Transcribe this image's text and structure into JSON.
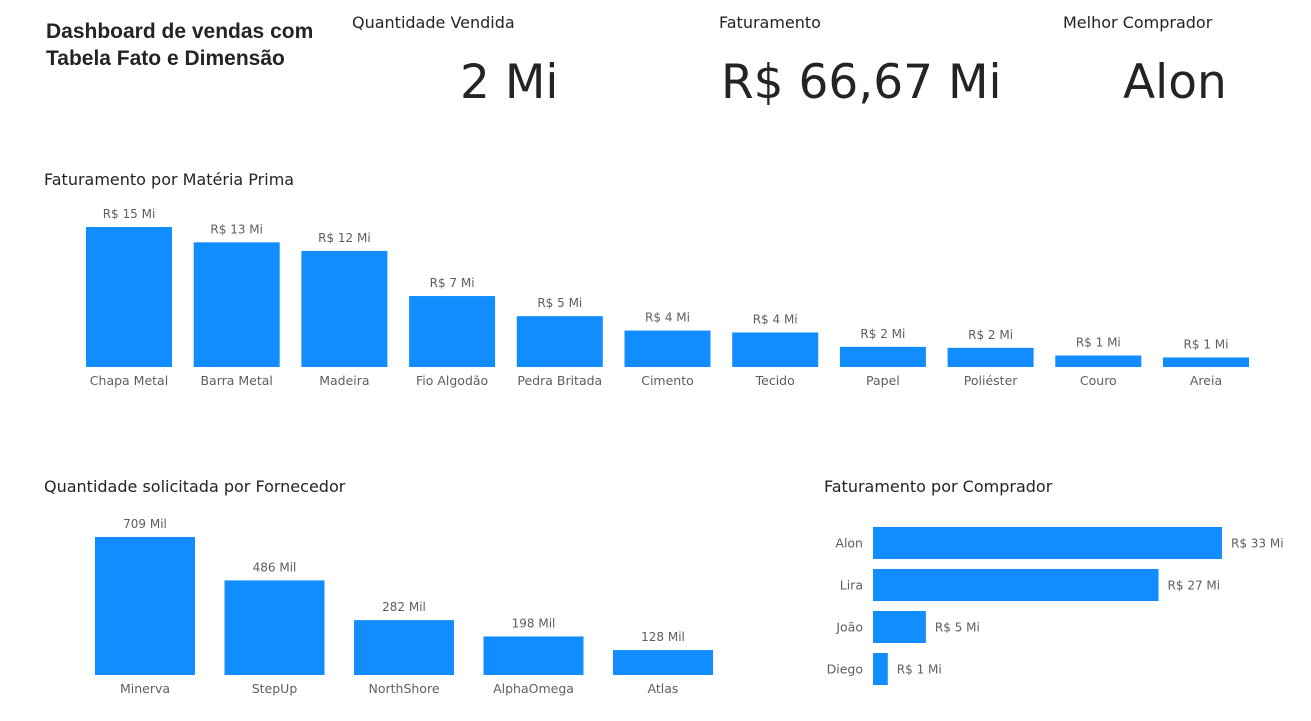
{
  "dashboard": {
    "title": "Dashboard de vendas com Tabela Fato e Dimensão"
  },
  "cards": [
    {
      "label": "Quantidade Vendida",
      "value": "2 Mi"
    },
    {
      "label": "Faturamento",
      "value": "R$ 66,67 Mi"
    },
    {
      "label": "Melhor Comprador",
      "value": "Alon"
    }
  ],
  "colors": {
    "bar": "#118DFF",
    "text": "#252423",
    "label": "#605E5C"
  },
  "chart_data": [
    {
      "type": "bar",
      "title": "Faturamento por Matéria Prima",
      "unit": "R$ Mi",
      "categories": [
        "Chapa Metal",
        "Barra Metal",
        "Madeira",
        "Fio Algodão",
        "Pedra Britada",
        "Cimento",
        "Tecido",
        "Papel",
        "Poliéster",
        "Couro",
        "Areia"
      ],
      "values": [
        14.6,
        13.0,
        12.1,
        7.4,
        5.3,
        3.8,
        3.6,
        2.1,
        2.0,
        1.2,
        1.0
      ],
      "data_labels": [
        "R$ 15 Mi",
        "R$ 13 Mi",
        "R$ 12 Mi",
        "R$ 7 Mi",
        "R$ 5 Mi",
        "R$ 4 Mi",
        "R$ 4 Mi",
        "R$ 2 Mi",
        "R$ 2 Mi",
        "R$ 1 Mi",
        "R$ 1 Mi"
      ],
      "grid": false,
      "ylim": [
        0,
        14.6
      ]
    },
    {
      "type": "bar",
      "title": "Quantidade solicitada por Fornecedor",
      "unit": "Mil",
      "categories": [
        "Minerva",
        "StepUp",
        "NorthShore",
        "AlphaOmega",
        "Atlas"
      ],
      "values": [
        709,
        486,
        282,
        198,
        128
      ],
      "data_labels": [
        "709 Mil",
        "486 Mil",
        "282 Mil",
        "198 Mil",
        "128 Mil"
      ],
      "grid": false,
      "ylim": [
        0,
        709
      ]
    },
    {
      "type": "bar",
      "orientation": "horizontal",
      "title": "Faturamento por Comprador",
      "unit": "R$ Mi",
      "categories": [
        "Alon",
        "Lira",
        "João",
        "Diego"
      ],
      "values": [
        33,
        27,
        5,
        1.4
      ],
      "data_labels": [
        "R$ 33 Mi",
        "R$ 27 Mi",
        "R$ 5 Mi",
        "R$ 1 Mi"
      ],
      "grid": false,
      "xlim": [
        0,
        33
      ]
    }
  ]
}
